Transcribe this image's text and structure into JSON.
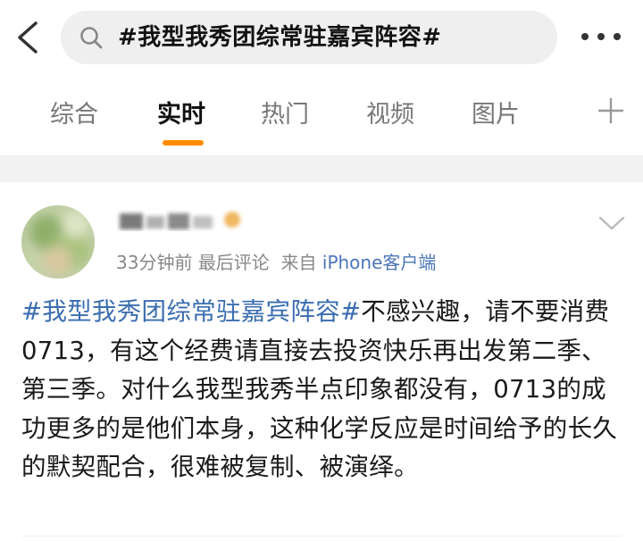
{
  "header": {
    "search_query": "#我型我秀团综常驻嘉宾阵容#"
  },
  "tabs": [
    {
      "label": "综合"
    },
    {
      "label": "实时"
    },
    {
      "label": "热门"
    },
    {
      "label": "视频"
    },
    {
      "label": "图片"
    }
  ],
  "active_tab": "实时",
  "post": {
    "time": "33分钟前",
    "activity": "最后评论",
    "source_prefix": "来自",
    "source": "iPhone客户端",
    "hashtag": "#我型我秀团综常驻嘉宾阵容#",
    "text": "不感兴趣，请不要消费0713，有这个经费请直接去投资快乐再出发第二季、第三季。对什么我型我秀半点印象都没有，0713的成功更多的是他们本身，这种化学反应是时间给予的长久的默契配合，很难被复制、被演绎。"
  },
  "colors": {
    "accent": "#ff8a00",
    "link": "#3a6db0",
    "meta": "#888888",
    "search_bg": "#efefef"
  }
}
